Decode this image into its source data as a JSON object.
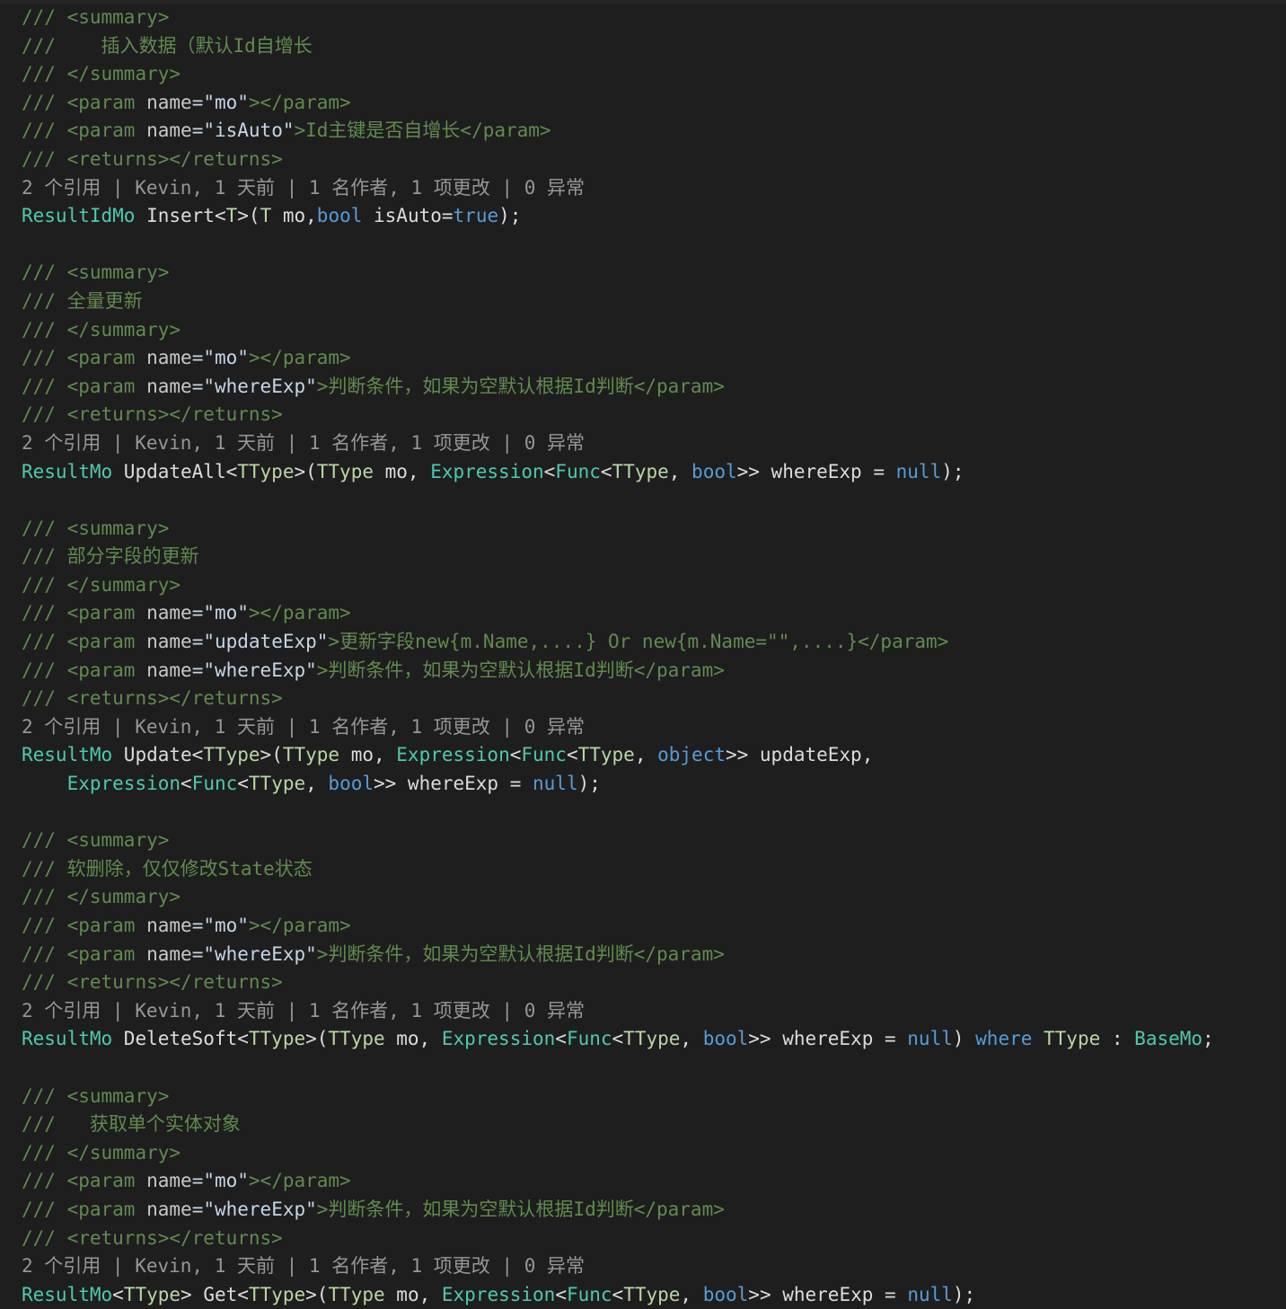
{
  "editor": {
    "language": "csharp",
    "theme": "dark-plus",
    "background_color": "#1e1e1e",
    "foreground_color": "#d4d4d4",
    "font_size_px": 21
  },
  "colors": {
    "comment": "#608b4e",
    "xml_attribute_name": "#c8c8c8",
    "xml_attribute_value": "#c5d6e8",
    "codelens": "#969696",
    "type": "#4ec9b0",
    "generic_param": "#b8d7a3",
    "keyword": "#569cd6",
    "identifier": "#dcdcdc"
  },
  "codelens": {
    "text": "2 个引用 | Kevin, 1 天前 | 1 名作者, 1 项更改 | 0 异常",
    "references": "2 个引用",
    "author": "Kevin, 1 天前",
    "changes": "1 名作者, 1 项更改",
    "exceptions": "0 异常"
  },
  "tokens": {
    "slashes": "///",
    "tag_summary_open": "<summary>",
    "tag_summary_close": "</summary>",
    "tag_returns": "<returns></returns>",
    "tag_param_open": "<param ",
    "attr_name": "name",
    "tag_close_bracket": ">",
    "tag_param_close": "</param>",
    "attr_mo": "=\"mo\"",
    "attr_isauto": "=\"isAuto\"",
    "attr_whereexp": "=\"whereExp\"",
    "attr_updateexp": "=\"updateExp\"",
    "empty_param_close": "></param>",
    "whereexp_desc": "判断条件，如果为空默认根据Id判断</param>",
    "isauto_desc": "Id主键是否自增长</param>",
    "updateexp_desc": "更新字段new{m.Name,....} Or new{m.Name=\"\",....}</param>"
  },
  "blocks": [
    {
      "id": "insert",
      "summary_text": "   插入数据（默认Id自增长",
      "signature_plain": "ResultIdMo Insert<T>(T mo,bool isAuto=true);"
    },
    {
      "id": "update-all",
      "summary_text": "全量更新",
      "signature_plain": "ResultMo UpdateAll<TType>(TType mo, Expression<Func<TType, bool>> whereExp = null);"
    },
    {
      "id": "update",
      "summary_text": "部分字段的更新",
      "signature_plain": "ResultMo Update<TType>(TType mo, Expression<Func<TType, object>> updateExp,",
      "signature_plain_2": "    Expression<Func<TType, bool>> whereExp = null);"
    },
    {
      "id": "delete-soft",
      "summary_text": "软删除，仅仅修改State状态",
      "signature_plain": "ResultMo DeleteSoft<TType>(TType mo, Expression<Func<TType, bool>> whereExp = null) where TType : BaseMo;"
    },
    {
      "id": "get",
      "summary_text": "  获取单个实体对象",
      "signature_plain": "ResultMo<TType> Get<TType>(TType mo, Expression<Func<TType, bool>> whereExp = null);"
    }
  ],
  "sig_parts": {
    "insert": {
      "ret_type": "ResultIdMo",
      "space1": " ",
      "name": "Insert",
      "lt": "<",
      "generic": "T",
      "gt_paren": ">(",
      "arg_type": "T",
      "arg_name": " mo,",
      "kw_bool": "bool",
      "arg2_name": " isAuto=",
      "kw_true": "true",
      "tail": ");"
    },
    "update_all": {
      "ret_type": "ResultMo",
      "name": " UpdateAll",
      "lt": "<",
      "generic": "TType",
      "gt_paren": ">(",
      "arg_type": "TType",
      "arg_name": " mo, ",
      "expr": "Expression",
      "lt2": "<",
      "func": "Func",
      "lt3": "<",
      "generic2": "TType",
      "comma": ", ",
      "kw_bool": "bool",
      "gt2": ">> whereExp = ",
      "kw_null": "null",
      "tail": ");"
    },
    "update": {
      "ret_type": "ResultMo",
      "name": " Update",
      "lt": "<",
      "generic": "TType",
      "gt_paren": ">(",
      "arg_type": "TType",
      "arg_name": " mo, ",
      "expr": "Expression",
      "lt2": "<",
      "func": "Func",
      "lt3": "<",
      "generic2": "TType",
      "comma": ", ",
      "kw_object": "object",
      "gt2": ">> updateExp,",
      "line2_indent": "    ",
      "expr2": "Expression",
      "lt4": "<",
      "func2": "Func",
      "lt5": "<",
      "generic3": "TType",
      "comma2": ", ",
      "kw_bool": "bool",
      "gt3": ">> whereExp = ",
      "kw_null": "null",
      "tail": ");"
    },
    "delete_soft": {
      "ret_type": "ResultMo",
      "name": " DeleteSoft",
      "lt": "<",
      "generic": "TType",
      "gt_paren": ">(",
      "arg_type": "TType",
      "arg_name": " mo, ",
      "expr": "Expression",
      "lt2": "<",
      "func": "Func",
      "lt3": "<",
      "generic2": "TType",
      "comma": ", ",
      "kw_bool": "bool",
      "gt2": ">> whereExp = ",
      "kw_null": "null",
      "close_paren": ") ",
      "kw_where": "where",
      "generic3": " TType",
      "colon": " : ",
      "base_type": "BaseMo",
      "tail": ";"
    },
    "get": {
      "ret_type": "ResultMo",
      "lt0": "<",
      "generic0": "TType",
      "gt0": "> ",
      "name": "Get",
      "lt": "<",
      "generic": "TType",
      "gt_paren": ">(",
      "arg_type": "TType",
      "arg_name": " mo, ",
      "expr": "Expression",
      "lt2": "<",
      "func": "Func",
      "lt3": "<",
      "generic2": "TType",
      "comma": ", ",
      "kw_bool": "bool",
      "gt2": ">> whereExp = ",
      "kw_null": "null",
      "tail": ");"
    }
  }
}
